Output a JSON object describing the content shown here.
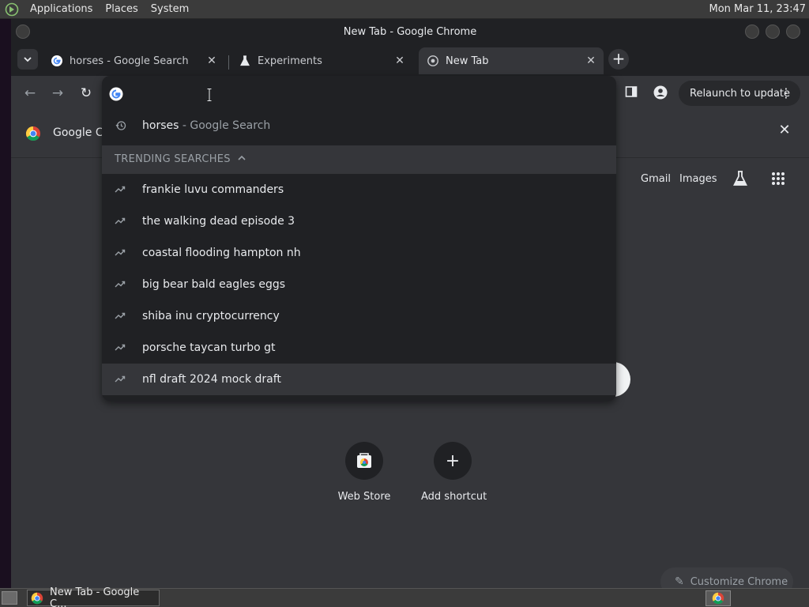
{
  "desktop": {
    "menus": [
      "Applications",
      "Places",
      "System"
    ],
    "clock": "Mon Mar 11, 23:47"
  },
  "window": {
    "title": "New Tab - Google Chrome"
  },
  "tabs": [
    {
      "title": "horses - Google Search",
      "favicon": "google-g-icon",
      "active": false
    },
    {
      "title": "Experiments",
      "favicon": "flask-icon",
      "active": false
    },
    {
      "title": "New Tab",
      "favicon": "chrome-icon",
      "active": true
    }
  ],
  "toolbar": {
    "relaunch_label": "Relaunch to update"
  },
  "infobar": {
    "text": "Google Ch"
  },
  "omnibox": {
    "value": "",
    "history": {
      "query": "horses",
      "suffix": " - Google Search"
    },
    "trending_header": "TRENDING SEARCHES",
    "trending": [
      "frankie luvu commanders",
      "the walking dead episode 3",
      "coastal flooding hampton nh",
      "big bear bald eagles eggs",
      "shiba inu cryptocurrency",
      "porsche taycan turbo gt",
      "nfl draft 2024 mock draft"
    ],
    "selected_index": 6
  },
  "ntp": {
    "links": [
      "Gmail",
      "Images"
    ],
    "shortcuts": [
      {
        "label": "Web Store",
        "icon": "web-store-icon"
      },
      {
        "label": "Add shortcut",
        "icon": "plus-icon"
      }
    ],
    "customize_label": "Customize Chrome"
  },
  "taskbar": {
    "task_label": "New Tab - Google C..."
  },
  "colors": {
    "frame": "#202124",
    "toolbar": "#35363a",
    "text": "#e8eaed",
    "muted": "#9aa0a6"
  }
}
